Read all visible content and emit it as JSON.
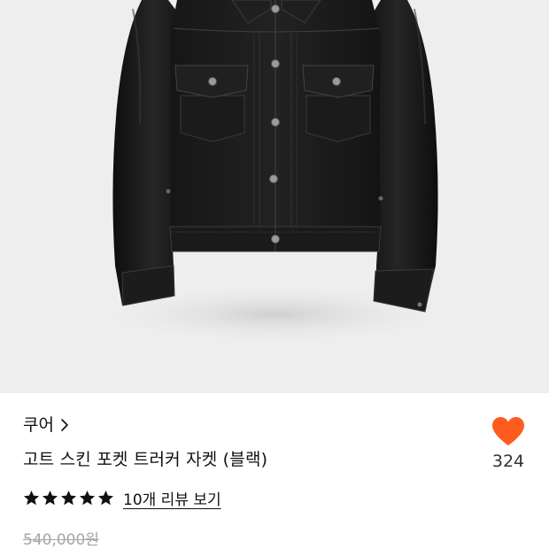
{
  "product": {
    "image_icon": "leather-jacket-image",
    "brand": "쿠어",
    "brand_chevron_icon": "chevron-right-icon",
    "title": "고트 스킨 포켓 트러커 자켓 (블랙)",
    "like": {
      "icon": "heart-icon",
      "count": "324",
      "color": "#ff5a1f"
    },
    "rating": {
      "stars": 5,
      "max": 5,
      "star_icon": "star-icon",
      "review_link": "10개 리뷰 보기"
    },
    "original_price": "540,000원"
  },
  "colors": {
    "image_background": "#eeeeee",
    "text": "#111111",
    "muted": "#a6a6a6",
    "accent": "#ff5a1f"
  }
}
